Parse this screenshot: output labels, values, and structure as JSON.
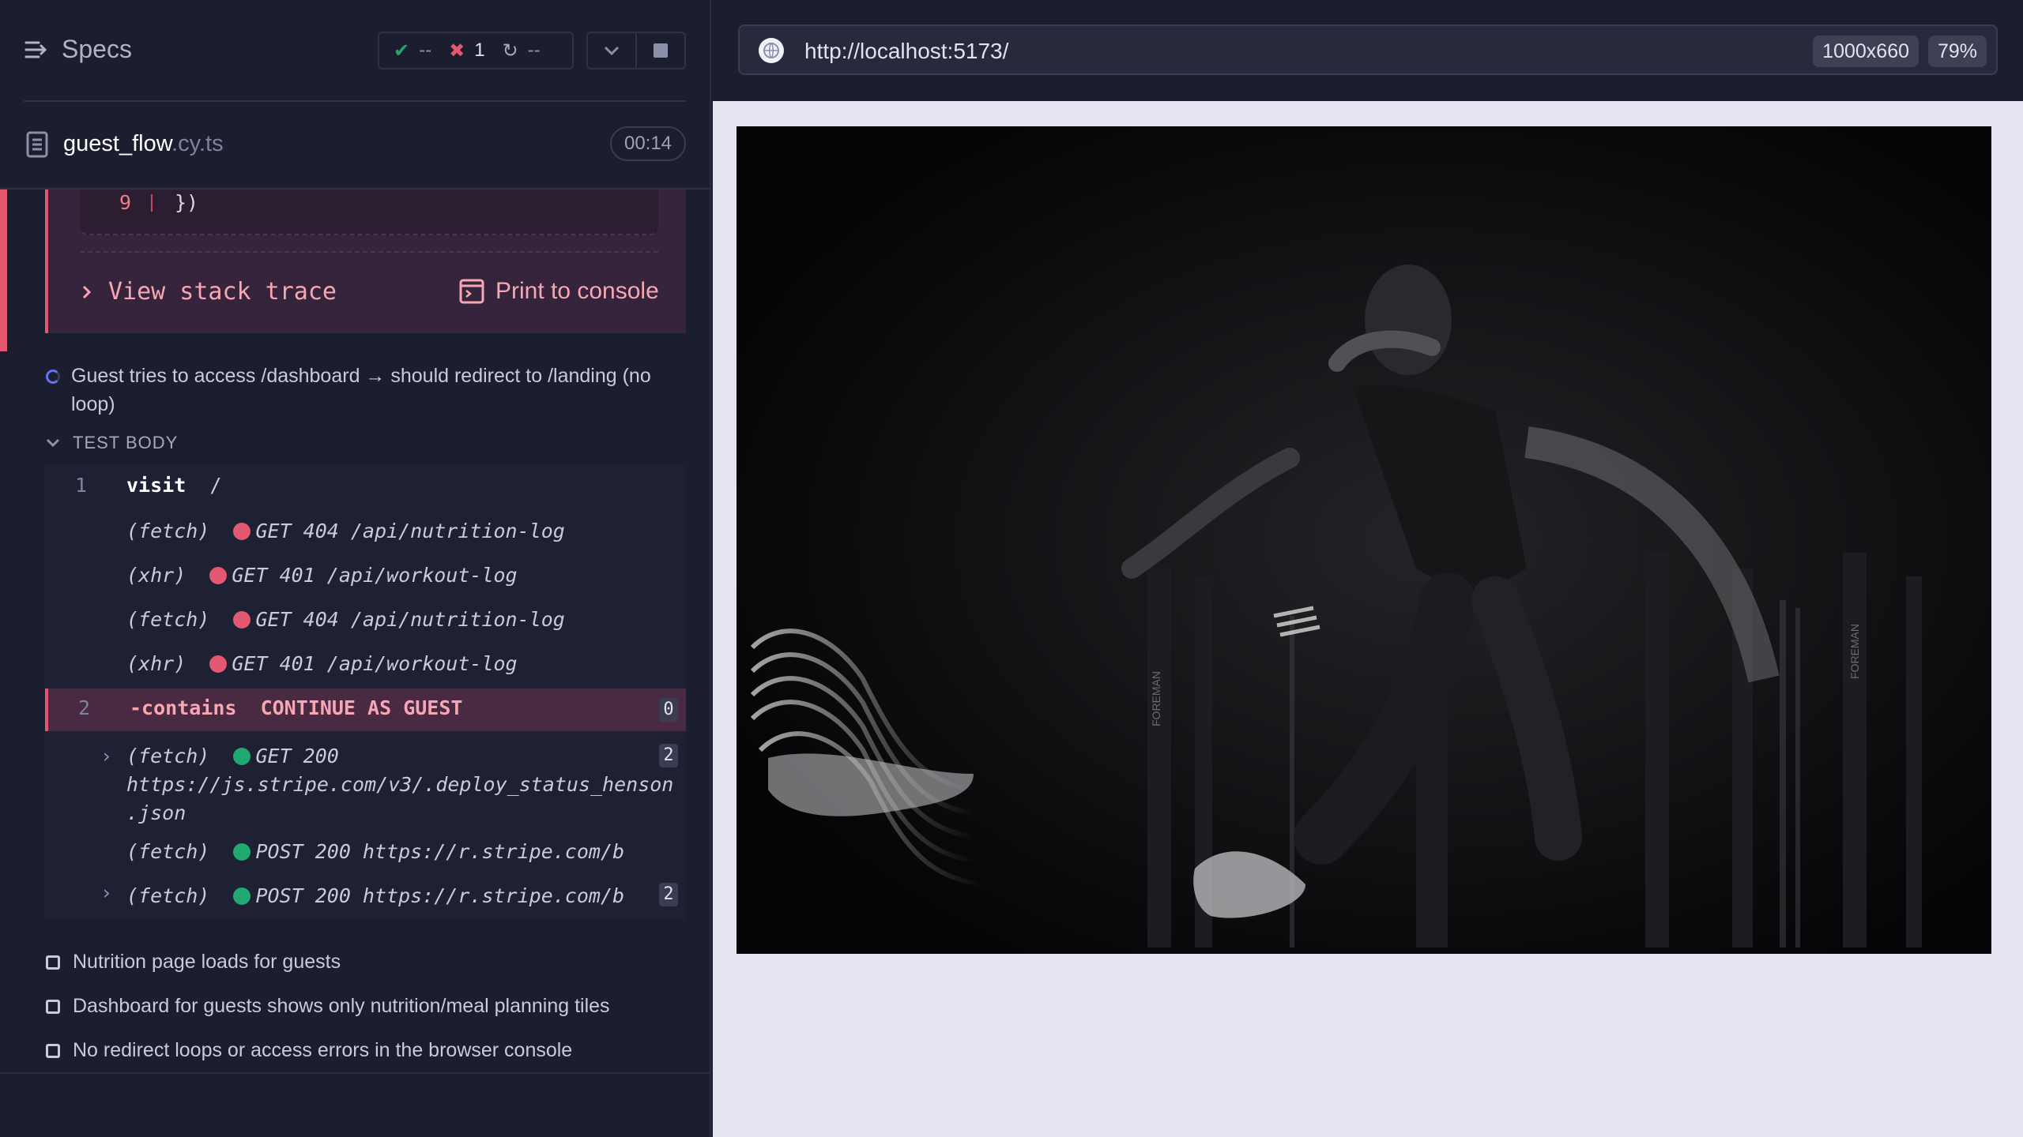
{
  "reporter": {
    "specs_label": "Specs",
    "stats": {
      "passed": "--",
      "failed": "1",
      "pending": "--"
    },
    "spec_file": {
      "name": "guest_flow",
      "ext": ".cy.ts",
      "duration": "00:14"
    },
    "error": {
      "code_line_number": "9",
      "code_line": "})",
      "view_stack_trace": "View stack trace",
      "print_to_console": "Print to console"
    },
    "running_test": {
      "title": "Guest tries to access /dashboard → should redirect to /landing (no loop)",
      "section": "TEST BODY",
      "commands": [
        {
          "num": "1",
          "name": "visit",
          "arg": "/"
        },
        {
          "kind": "(fetch)",
          "text": "GET 404 /api/nutrition-log",
          "status": "red"
        },
        {
          "kind": "(xhr)",
          "text": "GET 401 /api/workout-log",
          "status": "red"
        },
        {
          "kind": "(fetch)",
          "text": "GET 404 /api/nutrition-log",
          "status": "red"
        },
        {
          "kind": "(xhr)",
          "text": "GET 401 /api/workout-log",
          "status": "red"
        },
        {
          "num": "2",
          "name": "-contains",
          "arg": "CONTINUE AS GUEST",
          "count": "0"
        },
        {
          "kind": "(fetch)",
          "text": "GET 200",
          "url": "https://js.stripe.com/v3/.deploy_status_henson",
          "url2": ".json",
          "status": "green",
          "count": "2"
        },
        {
          "kind": "(fetch)",
          "text": "POST 200 https://r.stripe.com/b",
          "status": "green"
        },
        {
          "kind": "(fetch)",
          "text": "POST 200 https://r.stripe.com/b",
          "status": "green",
          "count": "2"
        }
      ]
    },
    "pending_tests": [
      "Nutrition page loads for guests",
      "Dashboard for guests shows only nutrition/meal planning tiles",
      "No redirect loops or access errors in the browser console"
    ]
  },
  "aut": {
    "url": "http://localhost:5173/",
    "viewport": "1000x660",
    "scale": "79%"
  },
  "colors": {
    "fail": "#e45770",
    "pass": "#1fa971",
    "running": "#6470f3",
    "panel_bg": "#1b1e2e"
  }
}
